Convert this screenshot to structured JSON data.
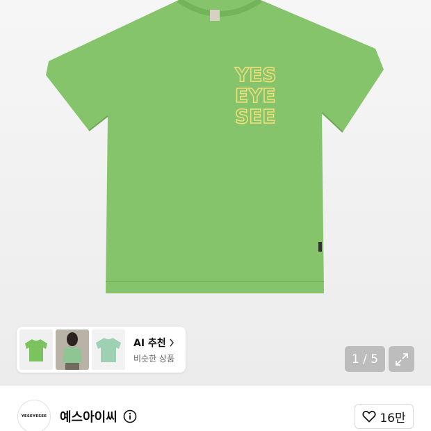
{
  "product_image": {
    "print_text": [
      "YES",
      "EYE",
      "SEE"
    ],
    "shirt_color": "#86c46c",
    "print_color": "#f2e07a"
  },
  "recommendation": {
    "title": "AI 추천",
    "subtitle": "비슷한 상품",
    "thumbnail_colors": [
      "#7cc35f",
      "#8fc493",
      "#9ed0b4"
    ]
  },
  "gallery": {
    "counter": "1 / 5",
    "expand_icon": "expand-icon"
  },
  "brand": {
    "logo_text": "YESEYESEE",
    "name": "예스아이씨",
    "info_icon": "info-icon"
  },
  "like": {
    "count": "16만",
    "icon": "heart-icon"
  }
}
